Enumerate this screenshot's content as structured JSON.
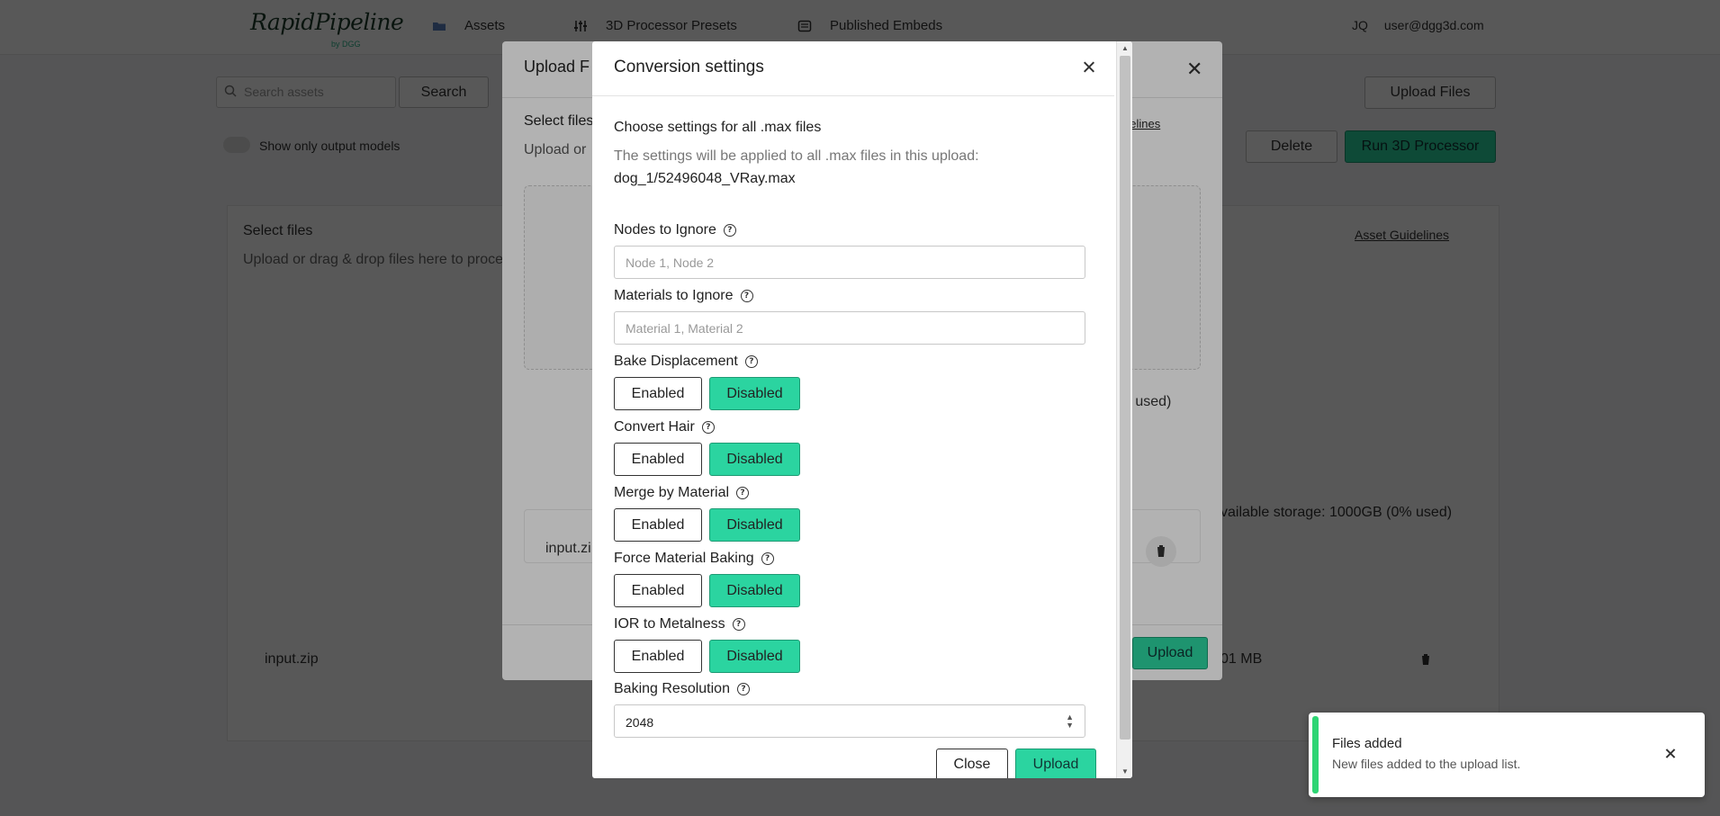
{
  "app": {
    "logo": "RapidPipeline",
    "logo_sub": "by DGG",
    "nav": {
      "assets": "Assets",
      "presets": "3D Processor Presets",
      "embeds": "Published Embeds"
    },
    "user_initials": "JQ",
    "user_email": "user@dgg3d.com"
  },
  "background": {
    "search_placeholder": "Search assets",
    "search_button": "Search",
    "upload_files": "Upload Files",
    "show_output": "Show only output models",
    "delete": "Delete",
    "run_processor": "Run 3D Processor",
    "select_files": "Select files",
    "upload_hint": "Upload or drag & drop files here to proce",
    "asset_guidelines": "Asset Guidelines",
    "storage": "vailable storage: 1000GB (0% used)",
    "file_name": "input.zip",
    "file_size": "01 MB"
  },
  "upload_modal": {
    "title": "Upload F",
    "select_files": "Select files",
    "upload_or": "Upload or",
    "guidelines": "delines",
    "storage": "o used)",
    "file_name": "input.zi",
    "upload_button": "Upload"
  },
  "conversion": {
    "title": "Conversion settings",
    "heading": "Choose settings for all .max files",
    "description": "The settings will be applied to all .max files in this upload:",
    "file": "dog_1/52496048_VRay.max",
    "nodes_label": "Nodes to Ignore",
    "nodes_placeholder": "Node 1, Node 2",
    "materials_label": "Materials to Ignore",
    "materials_placeholder": "Material 1, Material 2",
    "toggles": [
      {
        "label": "Bake Displacement",
        "enabled": "Enabled",
        "disabled": "Disabled",
        "value": "Disabled"
      },
      {
        "label": "Convert Hair",
        "enabled": "Enabled",
        "disabled": "Disabled",
        "value": "Disabled"
      },
      {
        "label": "Merge by Material",
        "enabled": "Enabled",
        "disabled": "Disabled",
        "value": "Disabled"
      },
      {
        "label": "Force Material Baking",
        "enabled": "Enabled",
        "disabled": "Disabled",
        "value": "Disabled"
      },
      {
        "label": "IOR to Metalness",
        "enabled": "Enabled",
        "disabled": "Disabled",
        "value": "Disabled"
      }
    ],
    "baking_label": "Baking Resolution",
    "baking_value": "2048",
    "close_button": "Close",
    "upload_button": "Upload"
  },
  "toast": {
    "title": "Files added",
    "message": "New files added to the upload list."
  },
  "colors": {
    "accent": "#2bd4a0",
    "toast_success": "#2ed573"
  }
}
